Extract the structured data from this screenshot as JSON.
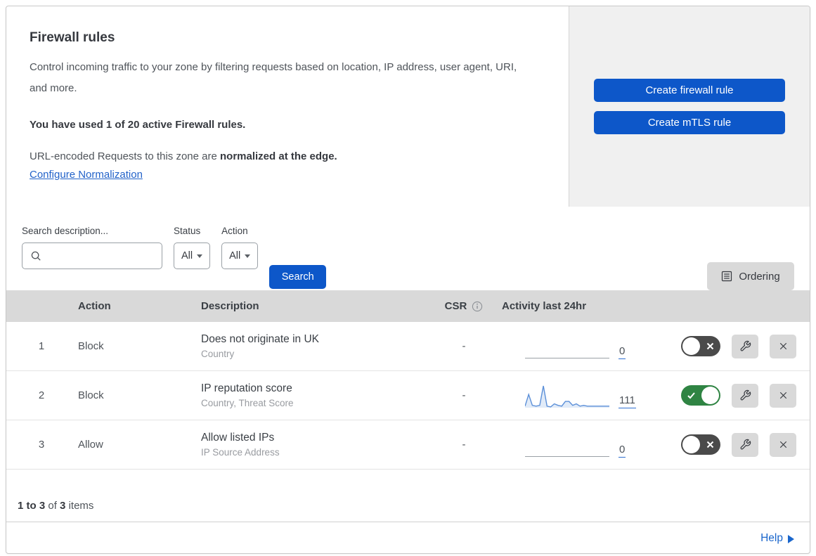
{
  "header": {
    "title": "Firewall rules",
    "description": "Control incoming traffic to your zone by filtering requests based on location, IP address, user agent, URI, and more.",
    "usage": "You have used 1 of 20 active Firewall rules.",
    "normalization_prefix": "URL-encoded Requests to this zone are ",
    "normalization_bold": "normalized at the edge.",
    "normalization_link": "Configure Normalization",
    "buttons": [
      {
        "label": "Create firewall rule"
      },
      {
        "label": "Create mTLS rule"
      }
    ]
  },
  "filters": {
    "search_label": "Search description...",
    "search_value": "",
    "status_label": "Status",
    "status_value": "All",
    "action_label": "Action",
    "action_value": "All",
    "search_button": "Search",
    "ordering_button": "Ordering"
  },
  "table": {
    "columns": {
      "action": "Action",
      "description": "Description",
      "csr": "CSR",
      "activity": "Activity last 24hr"
    },
    "rows": [
      {
        "index": "1",
        "action": "Block",
        "description": "Does not originate in UK",
        "criteria": "Country",
        "csr": "-",
        "activity_count": "0",
        "enabled": false,
        "sparkline_values": null
      },
      {
        "index": "2",
        "action": "Block",
        "description": "IP reputation score",
        "criteria": "Country, Threat Score",
        "csr": "-",
        "activity_count": "111",
        "enabled": true,
        "sparkline_values": [
          2,
          17,
          3,
          2,
          3,
          28,
          2,
          1,
          5,
          3,
          2,
          8,
          8,
          3,
          5,
          2,
          3,
          2,
          2,
          2,
          2,
          2,
          2,
          2
        ]
      },
      {
        "index": "3",
        "action": "Allow",
        "description": "Allow listed IPs",
        "criteria": "IP Source Address",
        "csr": "-",
        "activity_count": "0",
        "enabled": false,
        "sparkline_values": null
      }
    ],
    "footer": {
      "range": "1 to 3",
      "of": " of ",
      "total": "3",
      "items": " items"
    }
  },
  "help": {
    "label": "Help"
  },
  "colors": {
    "primary_blue": "#0d57c9",
    "link_blue": "#2262c9",
    "toggle_on_green": "#2f8443",
    "toggle_off_gray": "#4a4a4a",
    "sparkline_blue": "#5b8fd8",
    "sparkline_fill": "rgba(91,143,216,0.18)",
    "table_header_gray": "#d9d9d9"
  }
}
